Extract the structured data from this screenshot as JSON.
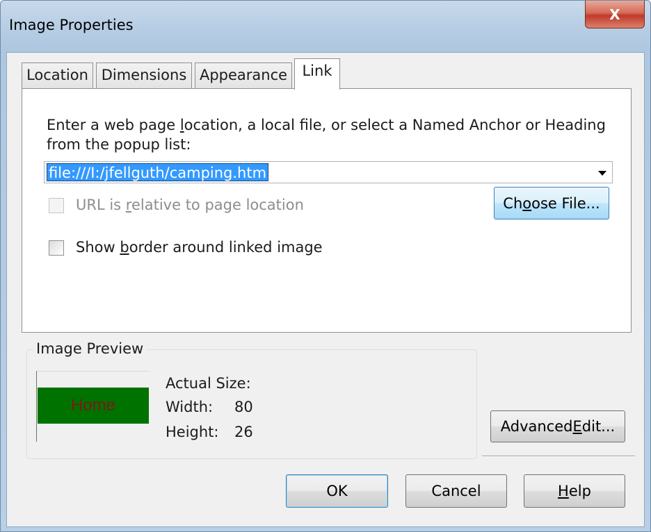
{
  "window": {
    "title": "Image Properties",
    "close_glyph": "X"
  },
  "tabs": [
    {
      "label": "Location",
      "active": false
    },
    {
      "label": "Dimensions",
      "active": false
    },
    {
      "label": "Appearance",
      "active": false
    },
    {
      "label": "Link",
      "active": true
    }
  ],
  "link_tab": {
    "instruction": {
      "pre": "Enter a web page ",
      "accel": "l",
      "post": "ocation, a local file, or select a Named Anchor or Heading from the popup list:"
    },
    "url_value": "file:///I:/jfellguth/camping.htm",
    "relative_checkbox": {
      "pre": "URL is ",
      "accel": "r",
      "post": "elative to page location",
      "checked": false,
      "enabled": false
    },
    "choose_file_button": {
      "pre": "Ch",
      "accel": "o",
      "post": "ose File..."
    },
    "border_checkbox": {
      "pre": "Show ",
      "accel": "b",
      "post": "order around linked image",
      "checked": false,
      "enabled": true
    }
  },
  "preview": {
    "legend": "Image Preview",
    "image_text": "Home",
    "actual_size_label": "Actual Size:",
    "width_label": "Width:",
    "width_value": "80",
    "height_label": "Height:",
    "height_value": "26"
  },
  "buttons": {
    "advanced": {
      "pre": "Advanced ",
      "accel": "E",
      "post": "dit..."
    },
    "ok": "OK",
    "cancel": "Cancel",
    "help": {
      "pre": "",
      "accel": "H",
      "post": "elp"
    }
  },
  "colors": {
    "selection": "#3399ff",
    "preview_bg": "#007200",
    "preview_text": "#7a1a1a",
    "close_button": "#c0392b"
  }
}
